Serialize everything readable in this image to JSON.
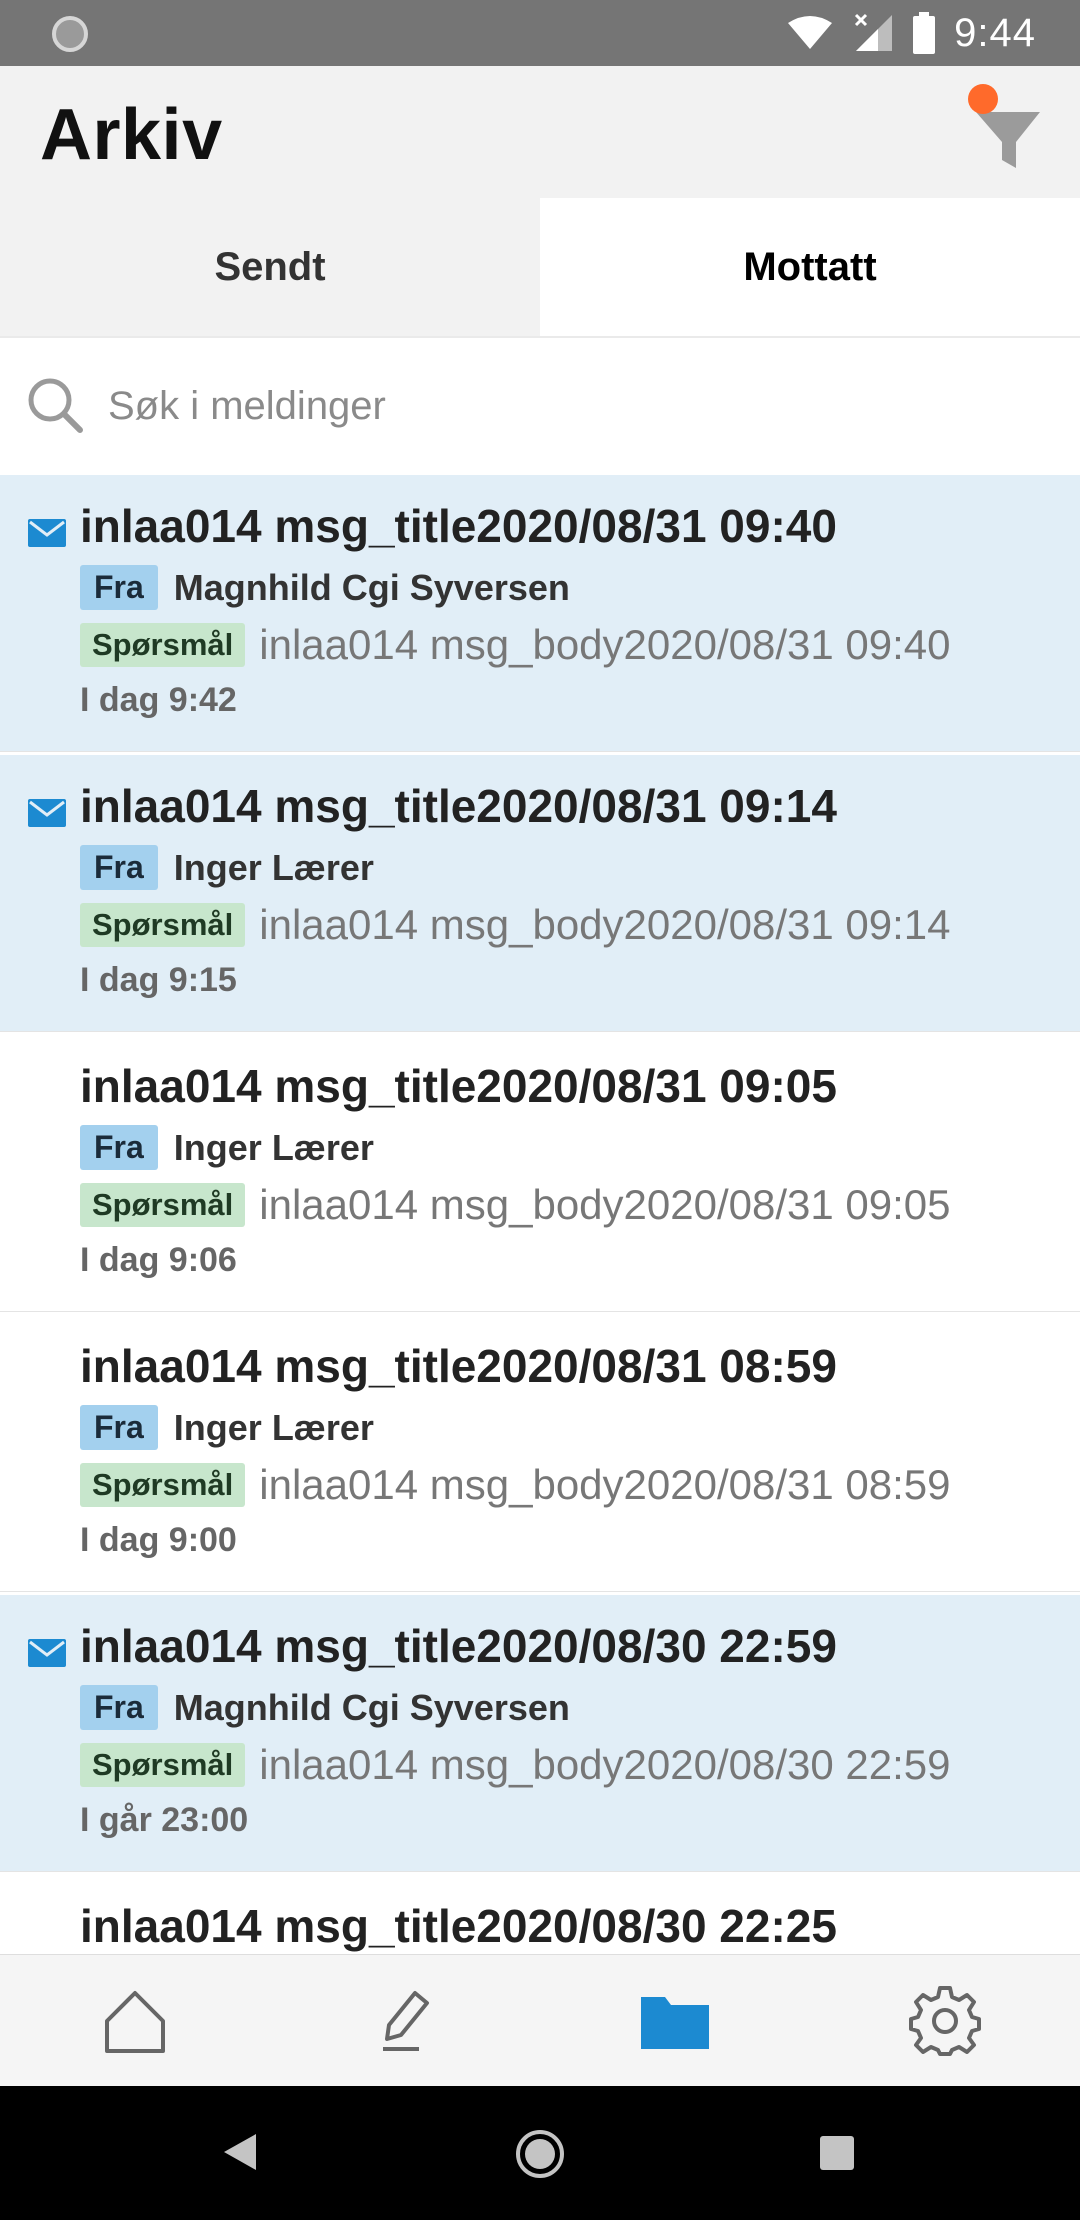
{
  "status_bar": {
    "time": "9:44"
  },
  "header": {
    "title": "Arkiv"
  },
  "tabs": [
    {
      "label": "Sendt",
      "active": false
    },
    {
      "label": "Mottatt",
      "active": true
    }
  ],
  "search": {
    "placeholder": "Søk i meldinger"
  },
  "messages": [
    {
      "title": "inlaa014 msg_title2020/08/31 09:40",
      "from_label": "Fra",
      "sender": "Magnhild Cgi Syversen",
      "type": "Spørsmål",
      "body": "inlaa014 msg_body2020/08/31 09:40",
      "time": "I dag 9:42",
      "unread": true
    },
    {
      "title": "inlaa014 msg_title2020/08/31 09:14",
      "from_label": "Fra",
      "sender": "Inger Lærer",
      "type": "Spørsmål",
      "body": "inlaa014 msg_body2020/08/31 09:14",
      "time": "I dag 9:15",
      "unread": true
    },
    {
      "title": "inlaa014 msg_title2020/08/31 09:05",
      "from_label": "Fra",
      "sender": "Inger Lærer",
      "type": "Spørsmål",
      "body": "inlaa014 msg_body2020/08/31 09:05",
      "time": "I dag 9:06",
      "unread": false
    },
    {
      "title": "inlaa014 msg_title2020/08/31 08:59",
      "from_label": "Fra",
      "sender": "Inger Lærer",
      "type": "Spørsmål",
      "body": "inlaa014 msg_body2020/08/31 08:59",
      "time": "I dag 9:00",
      "unread": false
    },
    {
      "title": "inlaa014 msg_title2020/08/30 22:59",
      "from_label": "Fra",
      "sender": "Magnhild Cgi Syversen",
      "type": "Spørsmål",
      "body": "inlaa014 msg_body2020/08/30 22:59",
      "time": "I går 23:00",
      "unread": true
    },
    {
      "title": "inlaa014 msg_title2020/08/30 22:25",
      "unread": false
    }
  ],
  "bottom_nav": [
    {
      "icon": "home-icon",
      "active": false
    },
    {
      "icon": "pencil-icon",
      "active": false
    },
    {
      "icon": "folder-icon",
      "active": true
    },
    {
      "icon": "gear-icon",
      "active": false
    }
  ],
  "colors": {
    "accent": "#1c8ad1",
    "unread_bg": "#e1eef7",
    "filter_dot": "#ff6a2b",
    "badge_from": "#a3d0ee",
    "badge_type": "#c7e6cc"
  }
}
